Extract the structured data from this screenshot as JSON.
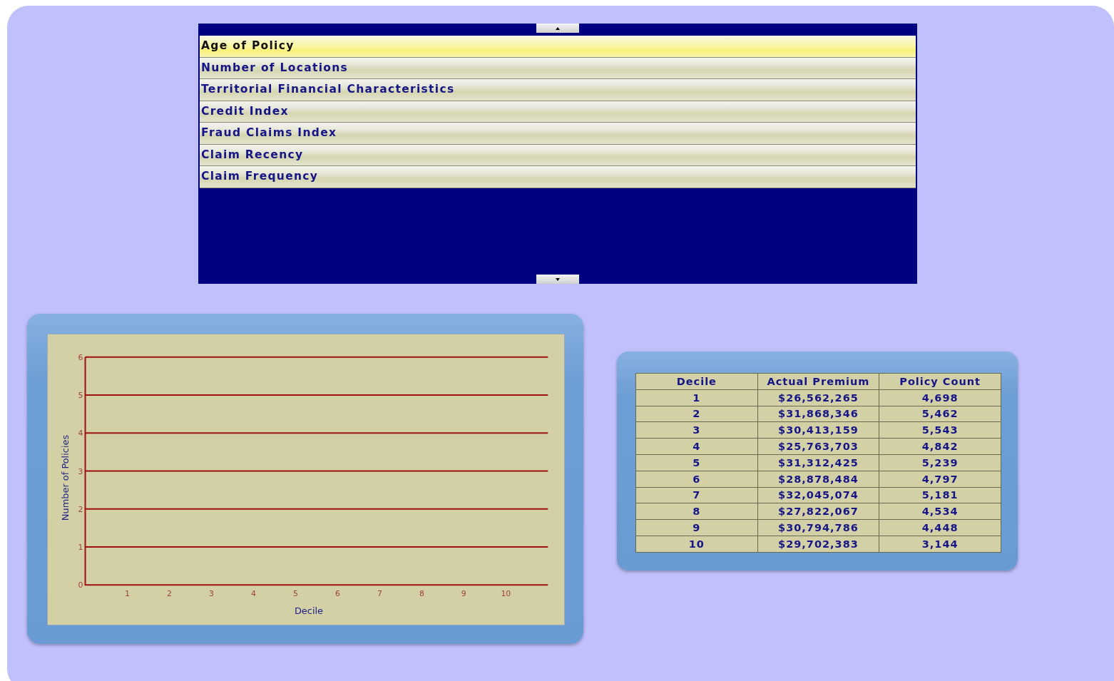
{
  "factor_list": {
    "items": [
      {
        "label": "Age of Policy",
        "selected": true
      },
      {
        "label": "Number of Locations",
        "selected": false
      },
      {
        "label": "Territorial Financial Characteristics",
        "selected": false
      },
      {
        "label": "Credit Index",
        "selected": false
      },
      {
        "label": "Fraud Claims Index",
        "selected": false
      },
      {
        "label": "Claim Recency",
        "selected": false
      },
      {
        "label": "Claim Frequency",
        "selected": false
      }
    ]
  },
  "chart": {
    "chart_data": {
      "type": "bar",
      "xlabel": "Decile",
      "ylabel": "Number of Policies",
      "categories": [
        "1",
        "2",
        "3",
        "4",
        "5",
        "6",
        "7",
        "8",
        "9",
        "10"
      ],
      "ylim": [
        0,
        6
      ],
      "grid": true,
      "yticks": [
        0,
        1,
        2,
        3,
        4,
        5,
        6
      ]
    }
  },
  "table": {
    "columns": [
      "Decile",
      "Actual Premium",
      "Policy Count"
    ],
    "rows": [
      [
        "1",
        "$26,562,265",
        "4,698"
      ],
      [
        "2",
        "$31,868,346",
        "5,462"
      ],
      [
        "3",
        "$30,413,159",
        "5,543"
      ],
      [
        "4",
        "$25,763,703",
        "4,842"
      ],
      [
        "5",
        "$31,312,425",
        "5,239"
      ],
      [
        "6",
        "$28,878,484",
        "4,797"
      ],
      [
        "7",
        "$32,045,074",
        "5,181"
      ],
      [
        "8",
        "$27,822,067",
        "4,534"
      ],
      [
        "9",
        "$30,794,786",
        "4,448"
      ],
      [
        "10",
        "$29,702,383",
        "3,144"
      ]
    ]
  }
}
